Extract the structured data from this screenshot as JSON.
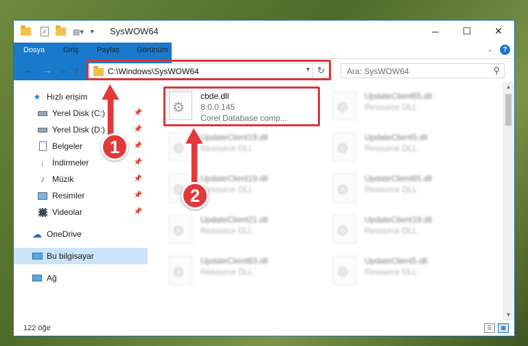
{
  "window": {
    "title": "SysWOW64",
    "minimize": "─",
    "maximize": "☐",
    "close": "✕"
  },
  "ribbon": {
    "tabs": [
      "Dosya",
      "Giriş",
      "Paylaş",
      "Görünüm"
    ],
    "help_label": "?"
  },
  "nav": {
    "back": "←",
    "forward": "→",
    "recent": "⌄",
    "up": "↑",
    "address": "C:\\Windows\\SysWOW64",
    "refresh": "↻",
    "search_placeholder": "Ara: SysWOW64"
  },
  "sidebar": {
    "items": [
      {
        "label": "Hızlı erişim",
        "icon": "star-icon",
        "pinned": false
      },
      {
        "label": "Yerel Disk (C:)",
        "icon": "drive-icon",
        "pinned": true
      },
      {
        "label": "Yerel Disk (D:)",
        "icon": "drive-icon",
        "pinned": true
      },
      {
        "label": "Belgeler",
        "icon": "documents-icon",
        "pinned": true
      },
      {
        "label": "İndirmeler",
        "icon": "download-icon",
        "pinned": true
      },
      {
        "label": "Müzik",
        "icon": "music-icon",
        "pinned": true
      },
      {
        "label": "Resimler",
        "icon": "pictures-icon",
        "pinned": true
      },
      {
        "label": "Videolar",
        "icon": "videos-icon",
        "pinned": true
      },
      {
        "label": "OneDrive",
        "icon": "cloud-icon",
        "pinned": false
      },
      {
        "label": "Bu bilgisayar",
        "icon": "computer-icon",
        "pinned": false
      },
      {
        "label": "Ağ",
        "icon": "network-icon",
        "pinned": false
      }
    ]
  },
  "files": [
    {
      "name": "cbde.dll",
      "line2": "8.0.0.145",
      "line3": "Corel Database comp...",
      "highlighted": true
    },
    {
      "name": "UpdateClient65.dll",
      "line2": "Resource DLL",
      "line3": ""
    },
    {
      "name": "UpdateClient19.dll",
      "line2": "Resource DLL",
      "line3": ""
    },
    {
      "name": "UpdateClient5.dll",
      "line2": "Resource DLL",
      "line3": ""
    },
    {
      "name": "UpdateClient19.dll",
      "line2": "Resource DLL",
      "line3": ""
    },
    {
      "name": "UpdateClient65.dll",
      "line2": "Resource DLL",
      "line3": ""
    },
    {
      "name": "UpdateClient21.dll",
      "line2": "Resource DLL",
      "line3": ""
    },
    {
      "name": "UpdateClient19.dll",
      "line2": "Resource DLL",
      "line3": ""
    },
    {
      "name": "UpdateClient63.dll",
      "line2": "Resource DLL",
      "line3": ""
    },
    {
      "name": "UpdateClient5.dll",
      "line2": "Resource DLL",
      "line3": ""
    }
  ],
  "status": {
    "count": "122 öğe"
  },
  "annotations": {
    "badge1": "1",
    "badge2": "2",
    "accent_color": "#e5383b"
  }
}
